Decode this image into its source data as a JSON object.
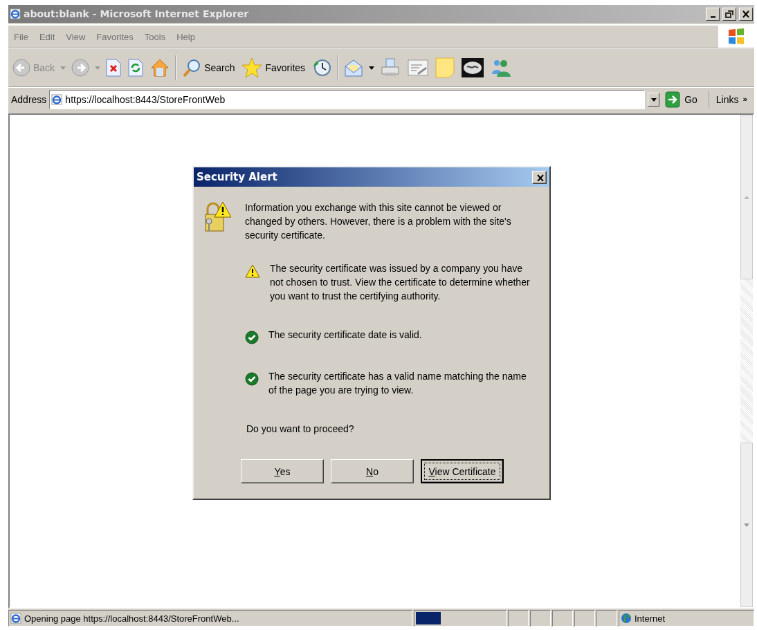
{
  "window": {
    "title": "about:blank - Microsoft Internet Explorer",
    "controls": [
      {
        "kind": "minimize"
      },
      {
        "kind": "restore"
      },
      {
        "kind": "close"
      }
    ]
  },
  "menu": [
    "File",
    "Edit",
    "View",
    "Favorites",
    "Tools",
    "Help"
  ],
  "toolbar": [
    {
      "kind": "back",
      "label": "Back",
      "disabled": true,
      "dropdown": true
    },
    {
      "kind": "forward",
      "disabled": true,
      "dropdown": true
    },
    {
      "kind": "stop"
    },
    {
      "kind": "refresh"
    },
    {
      "kind": "home"
    },
    {
      "kind": "separator"
    },
    {
      "kind": "search",
      "label": "Search"
    },
    {
      "kind": "favorites",
      "label": "Favorites"
    },
    {
      "kind": "history"
    },
    {
      "kind": "separator"
    },
    {
      "kind": "mail",
      "dropdown": true
    },
    {
      "kind": "print"
    },
    {
      "kind": "edit"
    },
    {
      "kind": "note"
    },
    {
      "kind": "spy"
    },
    {
      "kind": "messenger"
    }
  ],
  "address_bar": {
    "label": "Address",
    "value": "https://localhost:8443/StoreFrontWeb",
    "go": "Go",
    "links": "Links",
    "chevron": "»"
  },
  "dialog": {
    "title": "Security Alert",
    "intro": "Information you exchange with this site cannot be viewed or changed by others. However, there is a problem with the site's security certificate.",
    "checks": [
      {
        "kind": "warning",
        "text": "The security certificate was issued by a company you have not chosen to trust. View the certificate to determine whether you want to trust the certifying authority."
      },
      {
        "kind": "ok",
        "text": "The security certificate date is valid."
      },
      {
        "kind": "ok",
        "text": "The security certificate has a valid name matching the name of the page you are trying to view."
      }
    ],
    "question": "Do you want to proceed?",
    "buttons": [
      {
        "label": "Yes",
        "focused": false
      },
      {
        "label": "No",
        "focused": false
      },
      {
        "label": "View Certificate",
        "focused": true
      }
    ]
  },
  "status_bar": {
    "text": "Opening page https://localhost:8443/StoreFrontWeb...",
    "progress": {
      "level": 0.28
    },
    "zone": "Internet"
  }
}
